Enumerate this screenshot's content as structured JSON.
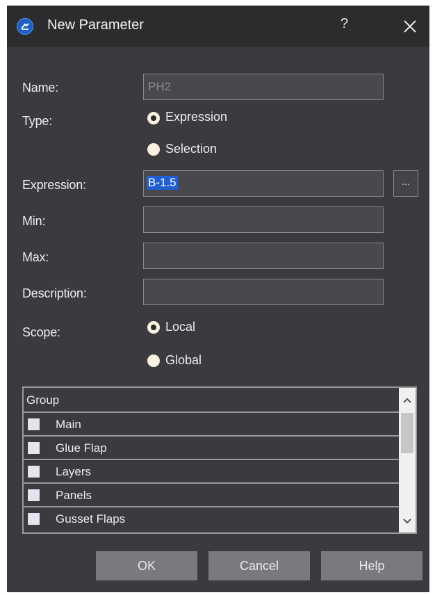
{
  "window": {
    "title": "New Parameter",
    "help": "?",
    "close_icon": "close-icon",
    "app_icon": "app-logo-icon"
  },
  "form": {
    "name_label": "Name:",
    "name_value": "PH2",
    "type_label": "Type:",
    "type_options": [
      {
        "label": "Expression",
        "checked": true
      },
      {
        "label": "Selection",
        "checked": false
      }
    ],
    "expression_label": "Expression:",
    "expression_value": "B-1.5",
    "expression_browse": "...",
    "min_label": "Min:",
    "min_value": "",
    "max_label": "Max:",
    "max_value": "",
    "description_label": "Description:",
    "description_value": "",
    "scope_label": "Scope:",
    "scope_options": [
      {
        "label": "Local",
        "checked": true
      },
      {
        "label": "Global",
        "checked": false
      }
    ]
  },
  "group_list": {
    "header": "Group",
    "items": [
      {
        "label": "Main",
        "checked": false
      },
      {
        "label": "Glue Flap",
        "checked": false
      },
      {
        "label": "Layers",
        "checked": false
      },
      {
        "label": "Panels",
        "checked": false
      },
      {
        "label": "Gusset Flaps",
        "checked": false
      }
    ]
  },
  "buttons": {
    "ok": "OK",
    "cancel": "Cancel",
    "help": "Help"
  },
  "colors": {
    "background": "#3b3b3f",
    "titlebar": "#2c2c2f",
    "selection": "#1f5fd0"
  }
}
